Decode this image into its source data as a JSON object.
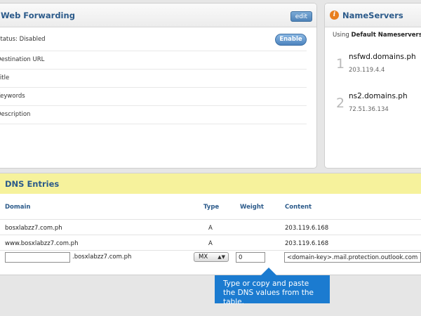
{
  "web_forwarding": {
    "title": "Web Forwarding",
    "edit_label": "edit",
    "status_label": "Status: Disabled",
    "enable_label": "Enable",
    "fields": [
      "Destination URL",
      "Title",
      "Keywords",
      "Description"
    ]
  },
  "nameservers": {
    "title": "NameServers",
    "info_icon": "info-icon",
    "using_prefix": "Using",
    "using_value": "Default Nameservers",
    "servers": [
      {
        "num": "1",
        "name": "nsfwd.domains.ph",
        "ip": "203.119.4.4"
      },
      {
        "num": "2",
        "name": "ns2.domains.ph",
        "ip": "72.51.36.134"
      }
    ]
  },
  "dns": {
    "title": "DNS Entries",
    "headers": {
      "domain": "Domain",
      "type": "Type",
      "weight": "Weight",
      "content": "Content"
    },
    "rows": [
      {
        "domain": "bosxlabzz7.com.ph",
        "type": "A",
        "content": "203.119.6.168"
      },
      {
        "domain": "www.bosxlabzz7.com.ph",
        "type": "A",
        "content": "203.119.6.168"
      }
    ],
    "new_entry": {
      "domain_value": "",
      "domain_suffix": ".bosxlabzz7.com.ph",
      "type_selected": "MX",
      "weight_value": "0",
      "content_value": "<domain-key>.mail.protection.outlook.com"
    }
  },
  "callout": {
    "text": "Type or copy and paste the DNS values from the table."
  },
  "colors": {
    "accent": "#2b5a8a",
    "highlight_band": "#f6f29c",
    "callout_bg": "#1b7bd0",
    "info_icon": "#e87f1f"
  }
}
